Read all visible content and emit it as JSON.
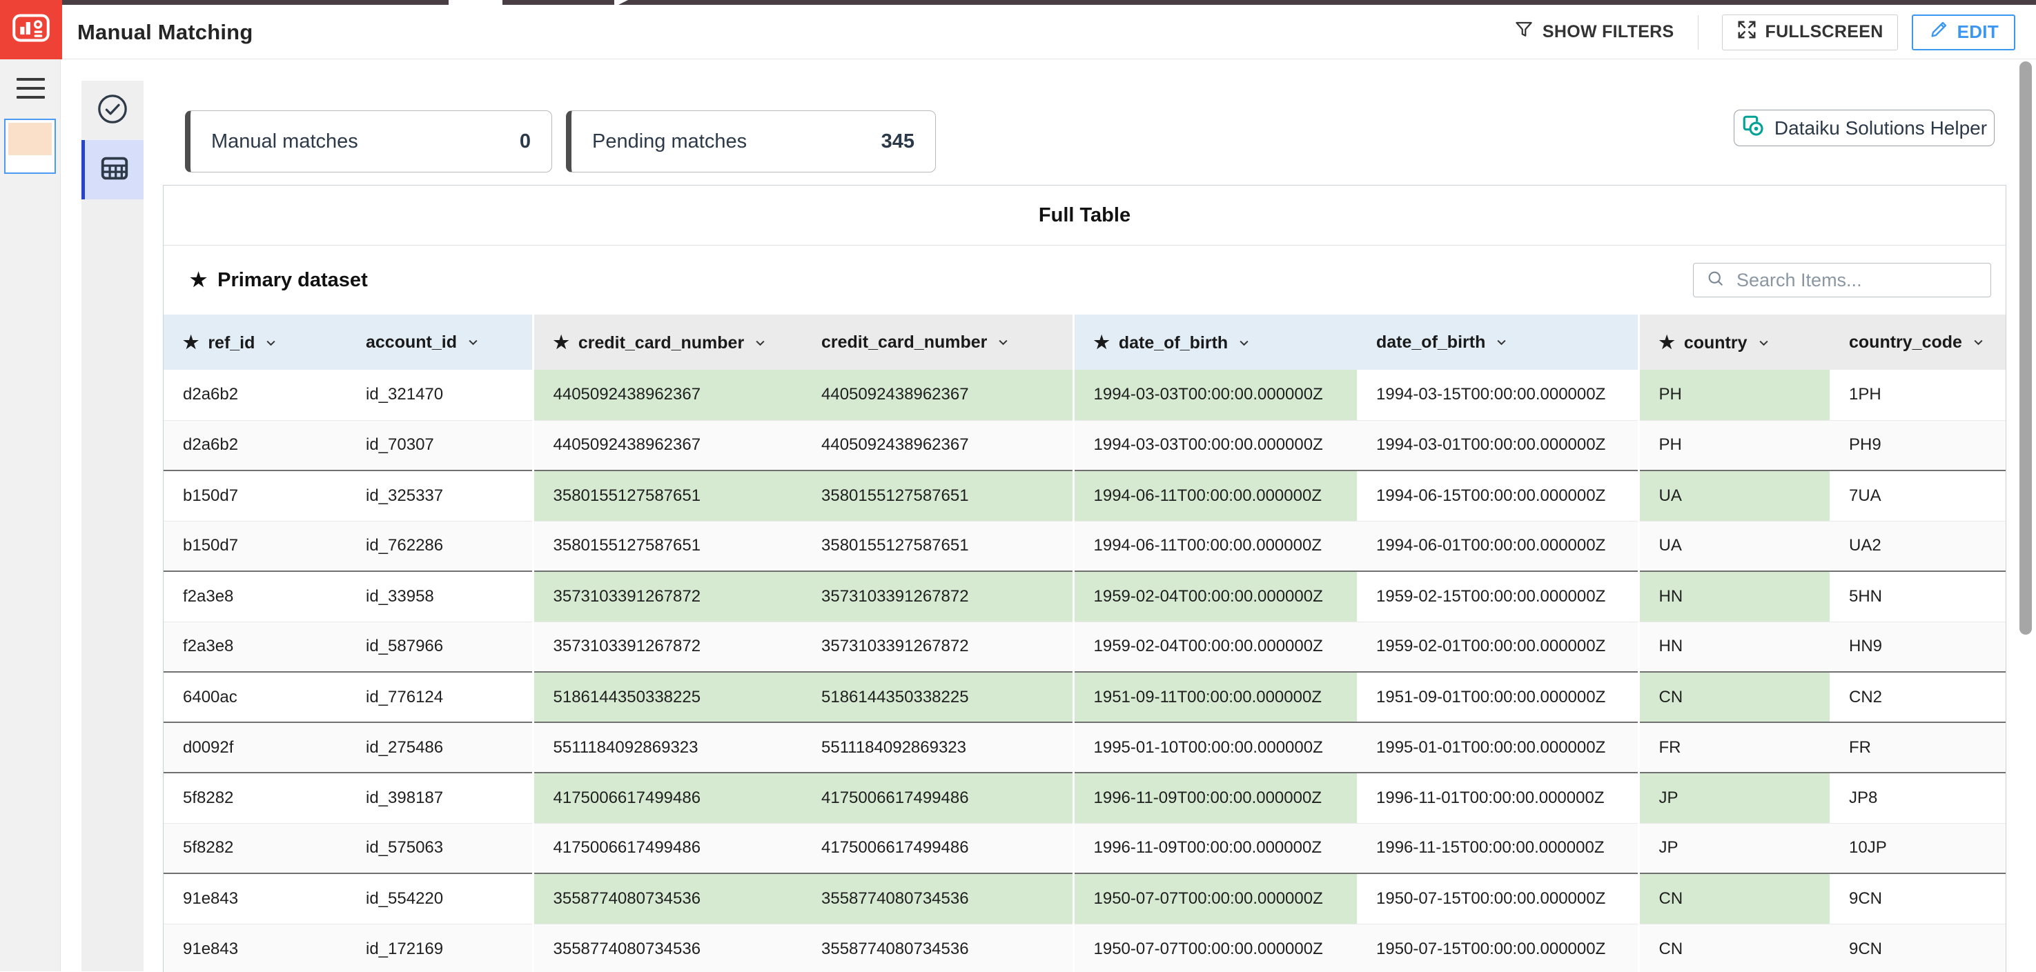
{
  "header": {
    "title": "Manual Matching",
    "show_filters_label": "SHOW FILTERS",
    "fullscreen_label": "FULLSCREEN",
    "edit_label": "EDIT"
  },
  "stats": [
    {
      "label": "Manual matches",
      "value": "0"
    },
    {
      "label": "Pending matches",
      "value": "345"
    }
  ],
  "helper_button": {
    "label": "Dataiku Solutions Helper"
  },
  "table": {
    "title": "Full Table",
    "dataset_label": "Primary dataset",
    "search_placeholder": "Search Items...",
    "columns": [
      {
        "name": "ref_id",
        "star": true,
        "group_color": "blue",
        "group_start": false
      },
      {
        "name": "account_id",
        "star": false,
        "group_color": "blue",
        "group_start": false
      },
      {
        "name": "credit_card_number",
        "star": true,
        "group_color": "gray",
        "group_start": true
      },
      {
        "name": "credit_card_number",
        "star": false,
        "group_color": "gray",
        "group_start": false
      },
      {
        "name": "date_of_birth",
        "star": true,
        "group_color": "blue",
        "group_start": true
      },
      {
        "name": "date_of_birth",
        "star": false,
        "group_color": "blue",
        "group_start": false
      },
      {
        "name": "country",
        "star": true,
        "group_color": "gray",
        "group_start": true
      },
      {
        "name": "country_code",
        "star": false,
        "group_color": "gray",
        "group_start": false
      }
    ],
    "match_pairs": [
      [
        2,
        3
      ],
      [
        4,
        5
      ],
      [
        6,
        7
      ]
    ],
    "rows": [
      [
        "d2a6b2",
        "id_321470",
        "4405092438962367",
        "4405092438962367",
        "1994-03-03T00:00:00.000000Z",
        "1994-03-15T00:00:00.000000Z",
        "PH",
        "1PH"
      ],
      [
        "d2a6b2",
        "id_70307",
        "4405092438962367",
        "4405092438962367",
        "1994-03-03T00:00:00.000000Z",
        "1994-03-01T00:00:00.000000Z",
        "PH",
        "PH9"
      ],
      [
        "b150d7",
        "id_325337",
        "3580155127587651",
        "3580155127587651",
        "1994-06-11T00:00:00.000000Z",
        "1994-06-15T00:00:00.000000Z",
        "UA",
        "7UA"
      ],
      [
        "b150d7",
        "id_762286",
        "3580155127587651",
        "3580155127587651",
        "1994-06-11T00:00:00.000000Z",
        "1994-06-01T00:00:00.000000Z",
        "UA",
        "UA2"
      ],
      [
        "f2a3e8",
        "id_33958",
        "3573103391267872",
        "3573103391267872",
        "1959-02-04T00:00:00.000000Z",
        "1959-02-15T00:00:00.000000Z",
        "HN",
        "5HN"
      ],
      [
        "f2a3e8",
        "id_587966",
        "3573103391267872",
        "3573103391267872",
        "1959-02-04T00:00:00.000000Z",
        "1959-02-01T00:00:00.000000Z",
        "HN",
        "HN9"
      ],
      [
        "6400ac",
        "id_776124",
        "5186144350338225",
        "5186144350338225",
        "1951-09-11T00:00:00.000000Z",
        "1951-09-01T00:00:00.000000Z",
        "CN",
        "CN2"
      ],
      [
        "d0092f",
        "id_275486",
        "5511184092869323",
        "5511184092869323",
        "1995-01-10T00:00:00.000000Z",
        "1995-01-01T00:00:00.000000Z",
        "FR",
        "FR"
      ],
      [
        "5f8282",
        "id_398187",
        "4175006617499486",
        "4175006617499486",
        "1996-11-09T00:00:00.000000Z",
        "1996-11-01T00:00:00.000000Z",
        "JP",
        "JP8"
      ],
      [
        "5f8282",
        "id_575063",
        "4175006617499486",
        "4175006617499486",
        "1996-11-09T00:00:00.000000Z",
        "1996-11-15T00:00:00.000000Z",
        "JP",
        "10JP"
      ],
      [
        "91e843",
        "id_554220",
        "3558774080734536",
        "3558774080734536",
        "1950-07-07T00:00:00.000000Z",
        "1950-07-15T00:00:00.000000Z",
        "CN",
        "9CN"
      ],
      [
        "91e843",
        "id_172169",
        "3558774080734536",
        "3558774080734536",
        "1950-07-07T00:00:00.000000Z",
        "1950-07-15T00:00:00.000000Z",
        "CN",
        "9CN"
      ]
    ]
  },
  "colors": {
    "brand_red": "#ee4237",
    "accent_blue": "#3b97f2",
    "helper_teal": "#00a296",
    "match_green": "#d6ead2",
    "header_group_blue": "#e3edf6",
    "header_group_gray": "#ebebeb",
    "active_nav_bg": "#d7def9",
    "active_nav_border": "#2944c9"
  }
}
